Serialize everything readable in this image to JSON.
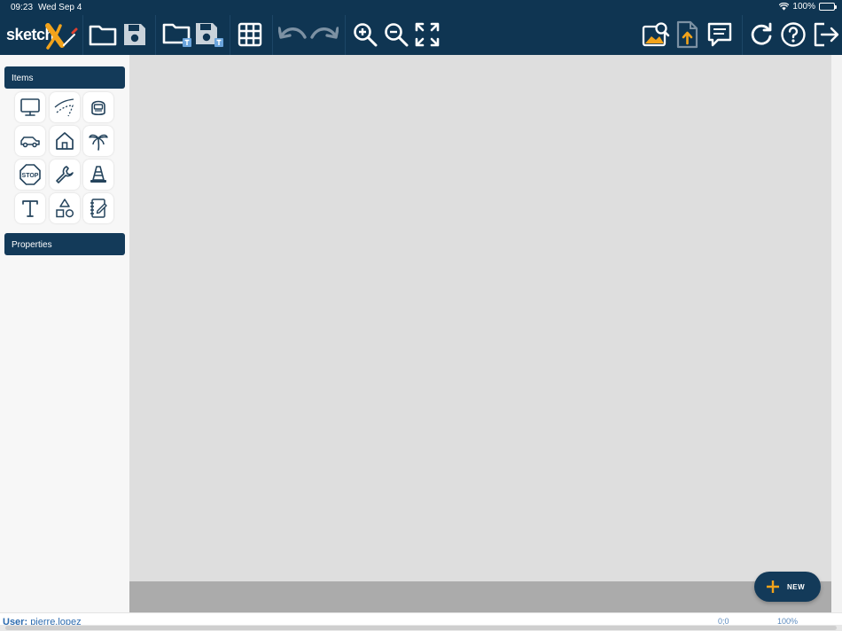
{
  "status_bar": {
    "time": "09:23",
    "date": "Wed Sep 4",
    "battery": "100%"
  },
  "app": {
    "logo_text": "sketch",
    "accent_color": "#f2a31b",
    "primary_color": "#0f3552"
  },
  "toolbar": {
    "buttons": [
      {
        "name": "open-folder-button",
        "icon": "folder-icon"
      },
      {
        "name": "save-button",
        "icon": "save-icon"
      },
      {
        "name": "open-template-button",
        "icon": "folder-template-icon"
      },
      {
        "name": "save-template-button",
        "icon": "save-template-icon"
      },
      {
        "name": "grid-button",
        "icon": "grid-icon"
      },
      {
        "name": "undo-button",
        "icon": "undo-icon"
      },
      {
        "name": "redo-button",
        "icon": "redo-icon"
      },
      {
        "name": "zoom-in-button",
        "icon": "zoom-in-icon"
      },
      {
        "name": "zoom-out-button",
        "icon": "zoom-out-icon"
      },
      {
        "name": "fit-screen-button",
        "icon": "fullscreen-icon"
      },
      {
        "name": "search-image-button",
        "icon": "image-search-icon"
      },
      {
        "name": "export-button",
        "icon": "file-export-icon"
      },
      {
        "name": "comments-button",
        "icon": "comment-icon"
      },
      {
        "name": "refresh-button",
        "icon": "refresh-icon"
      },
      {
        "name": "help-button",
        "icon": "help-icon"
      },
      {
        "name": "logout-button",
        "icon": "logout-icon"
      }
    ]
  },
  "sidebar": {
    "items_header": "Items",
    "properties_header": "Properties",
    "tools": [
      {
        "name": "monitor",
        "icon": "monitor-icon"
      },
      {
        "name": "road",
        "icon": "road-icon"
      },
      {
        "name": "helmet",
        "icon": "helmet-icon"
      },
      {
        "name": "car",
        "icon": "car-icon"
      },
      {
        "name": "house",
        "icon": "house-icon"
      },
      {
        "name": "palm-tree",
        "icon": "palm-tree-icon"
      },
      {
        "name": "stop-sign",
        "icon": "stop-sign-icon",
        "label": "STOP"
      },
      {
        "name": "wrench",
        "icon": "wrench-icon"
      },
      {
        "name": "traffic-cone",
        "icon": "traffic-cone-icon"
      },
      {
        "name": "text",
        "icon": "text-icon"
      },
      {
        "name": "shapes",
        "icon": "shapes-icon"
      },
      {
        "name": "notes",
        "icon": "notebook-icon"
      }
    ]
  },
  "fab": {
    "label": "NEW"
  },
  "footer": {
    "user_label": "User:",
    "user_name": "pierre.lopez",
    "coordinates": "0;0",
    "zoom": "100%"
  }
}
